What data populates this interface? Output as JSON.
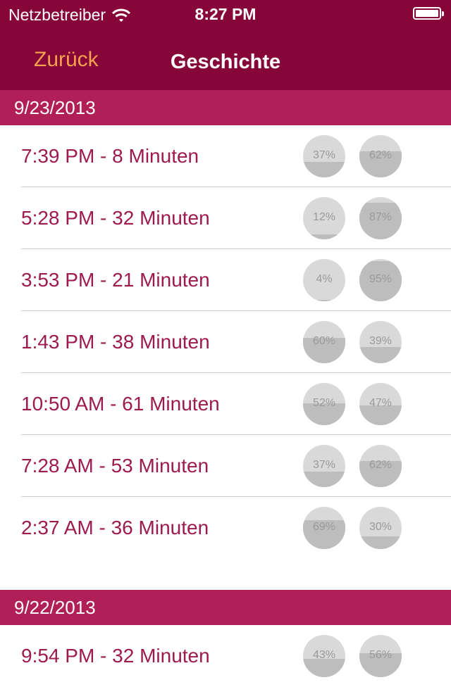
{
  "status_bar": {
    "carrier": "Netzbetreiber",
    "time": "8:27 PM"
  },
  "nav": {
    "back_label": "Zurück",
    "title": "Geschichte"
  },
  "colors": {
    "bar": "#86063a",
    "section": "#b01f56",
    "accent": "#f5a04e",
    "row_text": "#9c1a4d"
  },
  "sections": [
    {
      "date": "9/23/2013",
      "rows": [
        {
          "label": "7:39 PM - 8 Minuten",
          "a": "37%",
          "b": "62%"
        },
        {
          "label": "5:28 PM - 32 Minuten",
          "a": "12%",
          "b": "87%"
        },
        {
          "label": "3:53 PM - 21 Minuten",
          "a": "4%",
          "b": "95%"
        },
        {
          "label": "1:43 PM - 38 Minuten",
          "a": "60%",
          "b": "39%"
        },
        {
          "label": "10:50 AM - 61 Minuten",
          "a": "52%",
          "b": "47%"
        },
        {
          "label": "7:28 AM - 53 Minuten",
          "a": "37%",
          "b": "62%"
        },
        {
          "label": "2:37 AM - 36 Minuten",
          "a": "69%",
          "b": "30%"
        }
      ]
    },
    {
      "date": "9/22/2013",
      "rows": [
        {
          "label": "9:54 PM - 32 Minuten",
          "a": "43%",
          "b": "56%"
        }
      ]
    }
  ]
}
